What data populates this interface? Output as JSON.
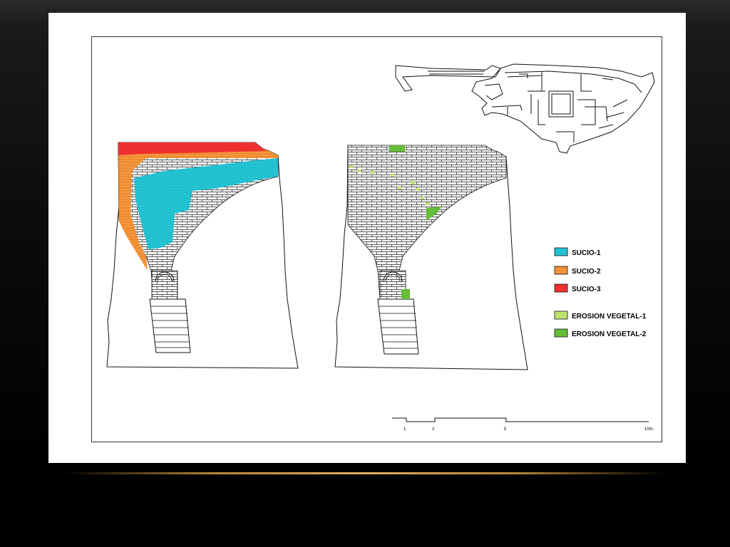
{
  "legend": {
    "items": [
      {
        "label": "SUCIO-1",
        "color": "#1ec0d0",
        "pattern": "pat-sucio1"
      },
      {
        "label": "SUCIO-2",
        "color": "#f08a2a",
        "pattern": "pat-sucio2"
      },
      {
        "label": "SUCIO-3",
        "color": "#ee2222",
        "pattern": "pat-sucio3"
      },
      {
        "label": "EROSION VEGETAL-1",
        "color": "#bde36a",
        "pattern": "pat-veg1"
      },
      {
        "label": "EROSION VEGETAL-2",
        "color": "#5ab82a",
        "pattern": "pat-veg2"
      }
    ]
  },
  "scale_bar": {
    "labels": [
      "1",
      "2",
      "5",
      "10m."
    ]
  }
}
